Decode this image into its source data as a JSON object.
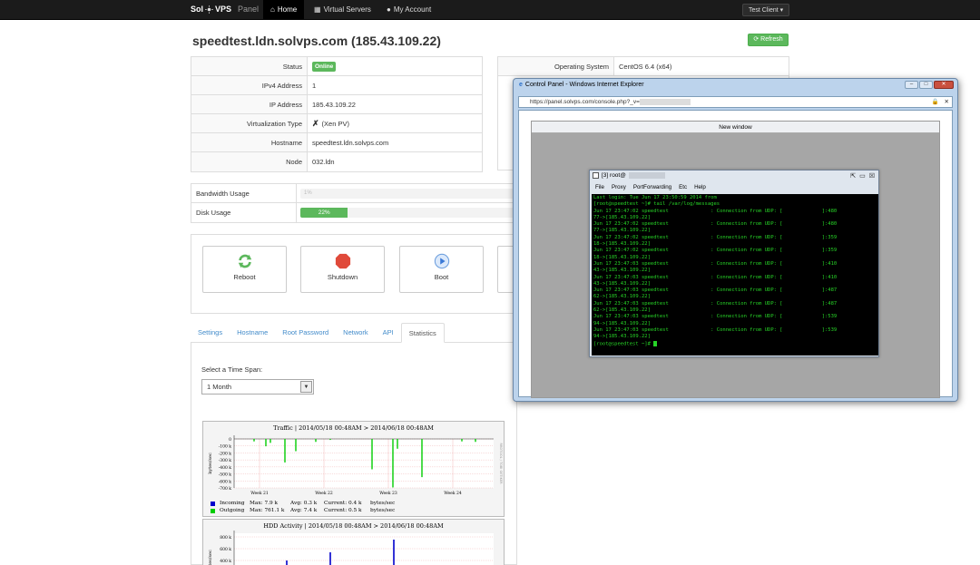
{
  "navbar": {
    "brand_a": "Sol",
    "brand_b": "VPS",
    "brand_c": "Panel",
    "items": [
      {
        "label": "Home",
        "icon": "home-icon"
      },
      {
        "label": "Virtual Servers",
        "icon": "grid-icon"
      },
      {
        "label": "My Account",
        "icon": "user-icon"
      }
    ],
    "user_label": "Test Client"
  },
  "page": {
    "title": "speedtest.ldn.solvps.com (185.43.109.22)",
    "refresh_label": "Refresh"
  },
  "info": {
    "status_label": "Status",
    "status_value": "Online",
    "ipv4_label": "IPv4 Address",
    "ipv4_value": "1",
    "ip_label": "IP Address",
    "ip_value": "185.43.109.22",
    "virt_label": "Virtualization Type",
    "virt_value": "(Xen PV)",
    "hostname_label": "Hostname",
    "hostname_value": "speedtest.ldn.solvps.com",
    "node_label": "Node",
    "node_value": "032.ldn",
    "os_label": "Operating System",
    "os_value": "CentOS 6.4 (x64)"
  },
  "usage": {
    "bandwidth_label": "Bandwidth Usage",
    "bandwidth_text": "1%",
    "bandwidth_fraction": 0.01,
    "disk_label": "Disk Usage",
    "disk_text": "22%",
    "disk_fraction": 0.22
  },
  "actions": [
    {
      "label": "Reboot",
      "icon": "reboot-icon"
    },
    {
      "label": "Shutdown",
      "icon": "shutdown-icon"
    },
    {
      "label": "Boot",
      "icon": "boot-icon"
    }
  ],
  "tabs": [
    "Settings",
    "Hostname",
    "Root Password",
    "Network",
    "API",
    "Statistics"
  ],
  "active_tab": "Statistics",
  "stats": {
    "timespan_label": "Select a Time Span:",
    "timespan_value": "1 Month"
  },
  "traffic_graph": {
    "title": "Traffic | 2014/05/18 00:48AM > 2014/06/18 00:48AM",
    "ylabel": "bytes/sec",
    "yticks": [
      "0",
      "-100 k",
      "-200 k",
      "-300 k",
      "-400 k",
      "-500 k",
      "-600 k",
      "-700 k"
    ],
    "xticks": [
      "Week 21",
      "Week 22",
      "Week 23",
      "Week 24"
    ],
    "side_label": "RRDTOOL / TOBI OETIKER",
    "legend": [
      {
        "name": "Incoming",
        "max": "Max:   7.9 k",
        "avg": "Avg:   0.3 k",
        "cur": "Current:   0.4 k",
        "unit": "bytes/sec",
        "color": "#0000cc"
      },
      {
        "name": "Outgoing",
        "max": "Max: 761.1 k",
        "avg": "Avg:   7.4 k",
        "cur": "Current:   0.5 k",
        "unit": "bytes/sec",
        "color": "#00cc00"
      }
    ],
    "spikes": [
      0.05,
      0.15,
      0.08,
      0.48,
      0.25,
      0.06,
      0.02,
      0.62,
      0.99,
      0.2,
      0.78,
      0.05,
      0.06
    ]
  },
  "hdd_graph": {
    "title": "HDD Activity | 2014/05/18 00:48AM > 2014/06/18 00:48AM",
    "ylabel": "bytes/sec",
    "yticks": [
      "800 k",
      "600 k",
      "400 k"
    ]
  },
  "ie": {
    "title": "Control Panel - Windows Internet Explorer",
    "url": "https://panel.solvps.com/console.php?_v=",
    "inner_title": "New window"
  },
  "terminal": {
    "title": "[3] root@",
    "menu": [
      "File",
      "Proxy",
      "PortForwarding",
      "Etc",
      "Help"
    ],
    "lines": [
      "Last login: Tue Jun 17 23:50:59 2014 from",
      "",
      "[root@speedtest ~]# tail /var/log/messages",
      "Jun 17 23:47:02 speedtest              : Connection from UDP: [             ]:480",
      "77->[185.43.109.22]",
      "Jun 17 23:47:02 speedtest              : Connection from UDP: [             ]:480",
      "77->[185.43.109.22]",
      "Jun 17 23:47:02 speedtest              : Connection from UDP: [             ]:359",
      "18->[185.43.109.22]",
      "Jun 17 23:47:02 speedtest              : Connection from UDP: [             ]:359",
      "18->[185.43.109.22]",
      "Jun 17 23:47:03 speedtest              : Connection from UDP: [             ]:410",
      "43->[185.43.109.22]",
      "Jun 17 23:47:03 speedtest              : Connection from UDP: [             ]:410",
      "43->[185.43.109.22]",
      "Jun 17 23:47:03 speedtest              : Connection from UDP: [             ]:487",
      "62->[185.43.109.22]",
      "Jun 17 23:47:03 speedtest              : Connection from UDP: [             ]:487",
      "62->[185.43.109.22]",
      "Jun 17 23:47:03 speedtest              : Connection from UDP: [             ]:539",
      "94->[185.43.109.22]",
      "Jun 17 23:47:03 speedtest              : Connection from UDP: [             ]:539",
      "94->[185.43.109.22]",
      "[root@speedtest ~]# "
    ]
  },
  "colors": {
    "success": "#5cb85c",
    "link": "#428bca",
    "terminal_fg": "#27d427",
    "navbar": "#1b1b1b"
  }
}
